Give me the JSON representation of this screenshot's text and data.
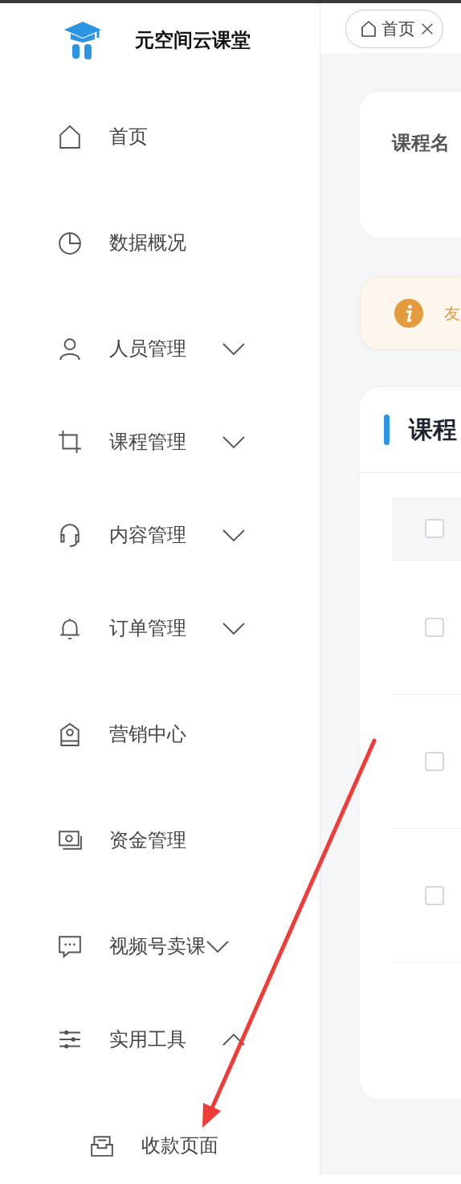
{
  "brand": {
    "name": "元空间云课堂"
  },
  "sidebar": {
    "items": [
      {
        "kind": "link",
        "label": "首页"
      },
      {
        "kind": "link",
        "label": "数据概况"
      },
      {
        "kind": "group",
        "label": "人员管理",
        "expanded": false
      },
      {
        "kind": "group",
        "label": "课程管理",
        "expanded": false
      },
      {
        "kind": "group",
        "label": "内容管理",
        "expanded": false
      },
      {
        "kind": "group",
        "label": "订单管理",
        "expanded": false
      },
      {
        "kind": "link",
        "label": "营销中心"
      },
      {
        "kind": "link",
        "label": "资金管理"
      },
      {
        "kind": "group",
        "label": "视频号卖课",
        "expanded": false
      },
      {
        "kind": "group",
        "label": "实用工具",
        "expanded": true,
        "children": [
          {
            "label": "收款页面"
          }
        ]
      }
    ]
  },
  "tabs": [
    {
      "label": "首页",
      "selected": true
    }
  ],
  "filter": {
    "label": "课程名"
  },
  "notice": {
    "text": "友"
  },
  "table_card": {
    "title": "课程",
    "header_checked": false,
    "rows": [
      {
        "checked": false
      },
      {
        "checked": false
      },
      {
        "checked": false
      }
    ]
  }
}
